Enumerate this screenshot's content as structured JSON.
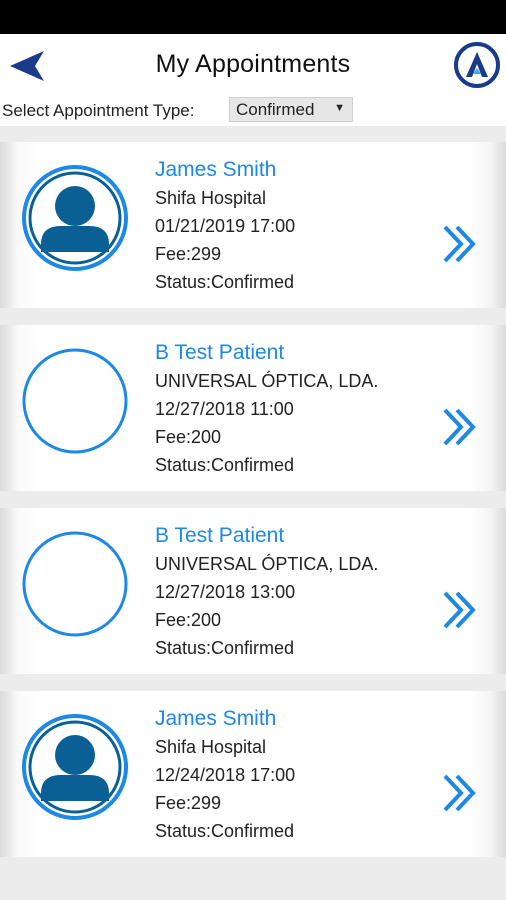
{
  "header": {
    "title": "My Appointments",
    "back_icon": "back-arrow-icon",
    "logo_icon": "app-logo-icon",
    "accent_color": "#1a3a8a"
  },
  "filter": {
    "label": "Select Appointment Type:",
    "selected": "Confirmed"
  },
  "appointments": [
    {
      "name": "James Smith",
      "location": "Shifa Hospital",
      "datetime": "01/21/2019 17:00",
      "fee": "Fee:299",
      "status": "Status:Confirmed",
      "avatar": "person-avatar-icon"
    },
    {
      "name": "B Test Patient",
      "location": "UNIVERSAL ÓPTICA, LDA.",
      "datetime": "12/27/2018 11:00",
      "fee": "Fee:200",
      "status": "Status:Confirmed",
      "avatar": "empty-avatar-icon"
    },
    {
      "name": "B Test Patient",
      "location": "UNIVERSAL ÓPTICA, LDA.",
      "datetime": "12/27/2018 13:00",
      "fee": "Fee:200",
      "status": "Status:Confirmed",
      "avatar": "empty-avatar-icon"
    },
    {
      "name": "James Smith",
      "location": "Shifa Hospital",
      "datetime": "12/24/2018 17:00",
      "fee": "Fee:299",
      "status": "Status:Confirmed",
      "avatar": "person-avatar-icon"
    }
  ],
  "colors": {
    "name_blue": "#1e88e5",
    "avatar_ring": "#1e88e5",
    "avatar_fill": "#0a5f95",
    "chevron": "#1e88e5"
  }
}
